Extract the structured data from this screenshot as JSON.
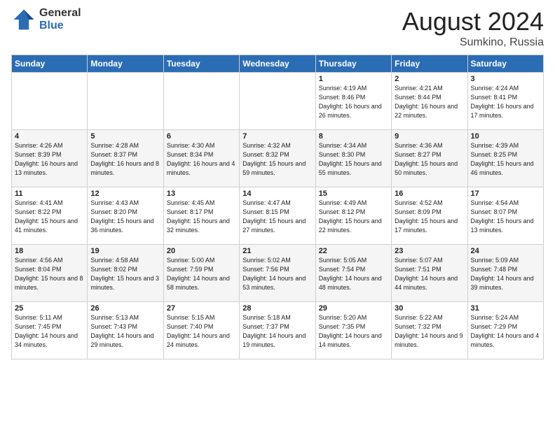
{
  "header": {
    "logo_general": "General",
    "logo_blue": "Blue",
    "title": "August 2024",
    "location": "Sumkino, Russia"
  },
  "days_of_week": [
    "Sunday",
    "Monday",
    "Tuesday",
    "Wednesday",
    "Thursday",
    "Friday",
    "Saturday"
  ],
  "weeks": [
    [
      {
        "day": "",
        "content": ""
      },
      {
        "day": "",
        "content": ""
      },
      {
        "day": "",
        "content": ""
      },
      {
        "day": "",
        "content": ""
      },
      {
        "day": "1",
        "content": "Sunrise: 4:19 AM\nSunset: 8:46 PM\nDaylight: 16 hours\nand 26 minutes."
      },
      {
        "day": "2",
        "content": "Sunrise: 4:21 AM\nSunset: 8:44 PM\nDaylight: 16 hours\nand 22 minutes."
      },
      {
        "day": "3",
        "content": "Sunrise: 4:24 AM\nSunset: 8:41 PM\nDaylight: 16 hours\nand 17 minutes."
      }
    ],
    [
      {
        "day": "4",
        "content": "Sunrise: 4:26 AM\nSunset: 8:39 PM\nDaylight: 16 hours\nand 13 minutes."
      },
      {
        "day": "5",
        "content": "Sunrise: 4:28 AM\nSunset: 8:37 PM\nDaylight: 16 hours\nand 8 minutes."
      },
      {
        "day": "6",
        "content": "Sunrise: 4:30 AM\nSunset: 8:34 PM\nDaylight: 16 hours\nand 4 minutes."
      },
      {
        "day": "7",
        "content": "Sunrise: 4:32 AM\nSunset: 8:32 PM\nDaylight: 15 hours\nand 59 minutes."
      },
      {
        "day": "8",
        "content": "Sunrise: 4:34 AM\nSunset: 8:30 PM\nDaylight: 15 hours\nand 55 minutes."
      },
      {
        "day": "9",
        "content": "Sunrise: 4:36 AM\nSunset: 8:27 PM\nDaylight: 15 hours\nand 50 minutes."
      },
      {
        "day": "10",
        "content": "Sunrise: 4:39 AM\nSunset: 8:25 PM\nDaylight: 15 hours\nand 46 minutes."
      }
    ],
    [
      {
        "day": "11",
        "content": "Sunrise: 4:41 AM\nSunset: 8:22 PM\nDaylight: 15 hours\nand 41 minutes."
      },
      {
        "day": "12",
        "content": "Sunrise: 4:43 AM\nSunset: 8:20 PM\nDaylight: 15 hours\nand 36 minutes."
      },
      {
        "day": "13",
        "content": "Sunrise: 4:45 AM\nSunset: 8:17 PM\nDaylight: 15 hours\nand 32 minutes."
      },
      {
        "day": "14",
        "content": "Sunrise: 4:47 AM\nSunset: 8:15 PM\nDaylight: 15 hours\nand 27 minutes."
      },
      {
        "day": "15",
        "content": "Sunrise: 4:49 AM\nSunset: 8:12 PM\nDaylight: 15 hours\nand 22 minutes."
      },
      {
        "day": "16",
        "content": "Sunrise: 4:52 AM\nSunset: 8:09 PM\nDaylight: 15 hours\nand 17 minutes."
      },
      {
        "day": "17",
        "content": "Sunrise: 4:54 AM\nSunset: 8:07 PM\nDaylight: 15 hours\nand 13 minutes."
      }
    ],
    [
      {
        "day": "18",
        "content": "Sunrise: 4:56 AM\nSunset: 8:04 PM\nDaylight: 15 hours\nand 8 minutes."
      },
      {
        "day": "19",
        "content": "Sunrise: 4:58 AM\nSunset: 8:02 PM\nDaylight: 15 hours\nand 3 minutes."
      },
      {
        "day": "20",
        "content": "Sunrise: 5:00 AM\nSunset: 7:59 PM\nDaylight: 14 hours\nand 58 minutes."
      },
      {
        "day": "21",
        "content": "Sunrise: 5:02 AM\nSunset: 7:56 PM\nDaylight: 14 hours\nand 53 minutes."
      },
      {
        "day": "22",
        "content": "Sunrise: 5:05 AM\nSunset: 7:54 PM\nDaylight: 14 hours\nand 48 minutes."
      },
      {
        "day": "23",
        "content": "Sunrise: 5:07 AM\nSunset: 7:51 PM\nDaylight: 14 hours\nand 44 minutes."
      },
      {
        "day": "24",
        "content": "Sunrise: 5:09 AM\nSunset: 7:48 PM\nDaylight: 14 hours\nand 39 minutes."
      }
    ],
    [
      {
        "day": "25",
        "content": "Sunrise: 5:11 AM\nSunset: 7:45 PM\nDaylight: 14 hours\nand 34 minutes."
      },
      {
        "day": "26",
        "content": "Sunrise: 5:13 AM\nSunset: 7:43 PM\nDaylight: 14 hours\nand 29 minutes."
      },
      {
        "day": "27",
        "content": "Sunrise: 5:15 AM\nSunset: 7:40 PM\nDaylight: 14 hours\nand 24 minutes."
      },
      {
        "day": "28",
        "content": "Sunrise: 5:18 AM\nSunset: 7:37 PM\nDaylight: 14 hours\nand 19 minutes."
      },
      {
        "day": "29",
        "content": "Sunrise: 5:20 AM\nSunset: 7:35 PM\nDaylight: 14 hours\nand 14 minutes."
      },
      {
        "day": "30",
        "content": "Sunrise: 5:22 AM\nSunset: 7:32 PM\nDaylight: 14 hours\nand 9 minutes."
      },
      {
        "day": "31",
        "content": "Sunrise: 5:24 AM\nSunset: 7:29 PM\nDaylight: 14 hours\nand 4 minutes."
      }
    ]
  ]
}
